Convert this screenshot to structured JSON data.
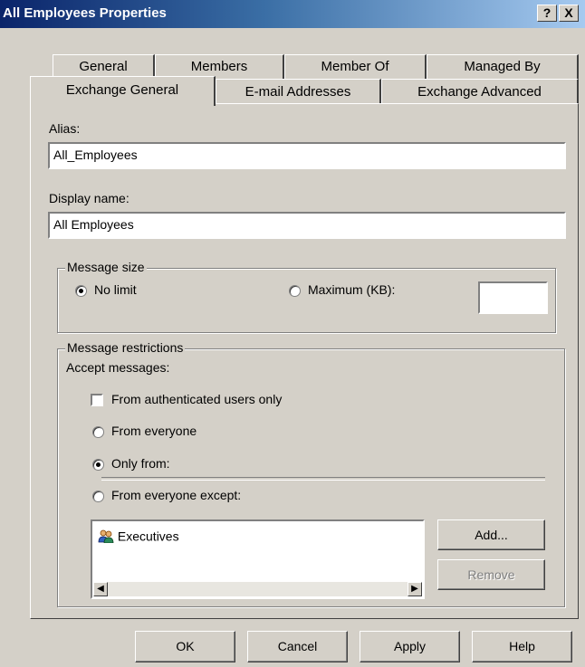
{
  "window": {
    "title": "All Employees Properties",
    "help_glyph": "?",
    "close_glyph": "X"
  },
  "tabs_row1": [
    "General",
    "Members",
    "Member Of",
    "Managed By"
  ],
  "tabs_row2": [
    "Exchange General",
    "E-mail Addresses",
    "Exchange Advanced"
  ],
  "active_tab": "Exchange General",
  "alias": {
    "label": "Alias:",
    "value": "All_Employees"
  },
  "display_name": {
    "label": "Display name:",
    "value": "All Employees"
  },
  "message_size": {
    "title": "Message size",
    "no_limit_label": "No limit",
    "maximum_label": "Maximum (KB):",
    "selected": "No limit",
    "maximum_value": ""
  },
  "message_restrictions": {
    "title": "Message restrictions",
    "accept_label": "Accept messages:",
    "authenticated_label": "From authenticated users only",
    "authenticated_checked": false,
    "from_everyone_label": "From everyone",
    "only_from_label": "Only from:",
    "everyone_except_label": "From everyone except:",
    "selected": "Only from:",
    "list_items": [
      {
        "name": "Executives",
        "icon": "group-icon"
      }
    ],
    "add_label": "Add...",
    "remove_label": "Remove"
  },
  "footer": {
    "ok": "OK",
    "cancel": "Cancel",
    "apply": "Apply",
    "help": "Help"
  }
}
